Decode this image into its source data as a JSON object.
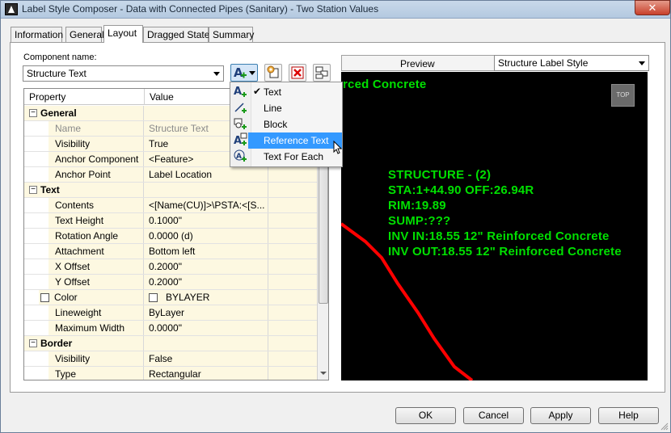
{
  "window": {
    "title": "Label Style Composer - Data with Connected Pipes (Sanitary) - Two Station Values",
    "close_glyph": "✕"
  },
  "tabs": [
    {
      "label": "Information",
      "active": false
    },
    {
      "label": "General",
      "active": false
    },
    {
      "label": "Layout",
      "active": true
    },
    {
      "label": "Dragged State",
      "active": false
    },
    {
      "label": "Summary",
      "active": false
    }
  ],
  "component": {
    "label": "Component name:",
    "value": "Structure Text"
  },
  "toolbar": {
    "icons": [
      "create-text-component-icon",
      "copy-component-icon",
      "delete-component-icon",
      "component-draw-order-icon"
    ]
  },
  "grid": {
    "headers": {
      "property": "Property",
      "value": "Value"
    },
    "rows": [
      {
        "type": "category",
        "label": "General"
      },
      {
        "type": "prop",
        "label": "Name",
        "value": "Structure Text",
        "disabled": true
      },
      {
        "type": "prop",
        "label": "Visibility",
        "value": "True"
      },
      {
        "type": "prop",
        "label": "Anchor Component",
        "value": "<Feature>"
      },
      {
        "type": "prop",
        "label": "Anchor Point",
        "value": "Label Location"
      },
      {
        "type": "category",
        "label": "Text"
      },
      {
        "type": "prop",
        "label": "Contents",
        "value": "<[Name(CU)]>\\PSTA:<[S..."
      },
      {
        "type": "prop",
        "label": "Text Height",
        "value": "0.1000\""
      },
      {
        "type": "prop",
        "label": "Rotation Angle",
        "value": "0.0000 (d)"
      },
      {
        "type": "prop",
        "label": "Attachment",
        "value": "Bottom left"
      },
      {
        "type": "prop",
        "label": "X Offset",
        "value": "0.2000\""
      },
      {
        "type": "prop",
        "label": "Y Offset",
        "value": "0.2000\""
      },
      {
        "type": "prop",
        "label": "Color",
        "value": "BYLAYER",
        "checkbox": true
      },
      {
        "type": "prop",
        "label": "Lineweight",
        "value": "ByLayer"
      },
      {
        "type": "prop",
        "label": "Maximum Width",
        "value": "0.0000\""
      },
      {
        "type": "category",
        "label": "Border"
      },
      {
        "type": "prop",
        "label": "Visibility",
        "value": "False"
      },
      {
        "type": "prop",
        "label": "Type",
        "value": "Rectangular"
      }
    ]
  },
  "menu": {
    "items": [
      {
        "label": "Text",
        "checked": true,
        "highlighted": false
      },
      {
        "label": "Line",
        "checked": false,
        "highlighted": false
      },
      {
        "label": "Block",
        "checked": false,
        "highlighted": false
      },
      {
        "label": "Reference Text",
        "checked": false,
        "highlighted": true
      },
      {
        "label": "Text For Each",
        "checked": false,
        "highlighted": false
      }
    ]
  },
  "preview": {
    "label": "Preview",
    "style_select": "Structure Label Style",
    "top_label": "TOP",
    "text_color": "#00e000",
    "pipe_color": "#ff0000",
    "partial_line": "rced Concrete",
    "lines": [
      "STRUCTURE - (2)",
      "STA:1+44.90 OFF:26.94R",
      "RIM:19.89",
      "SUMP:???",
      "INV IN:18.55 12\" Reinforced Concrete",
      "INV OUT:18.55 12\" Reinforced Concrete"
    ]
  },
  "buttons": {
    "ok": "OK",
    "cancel": "Cancel",
    "apply": "Apply",
    "help": "Help"
  }
}
